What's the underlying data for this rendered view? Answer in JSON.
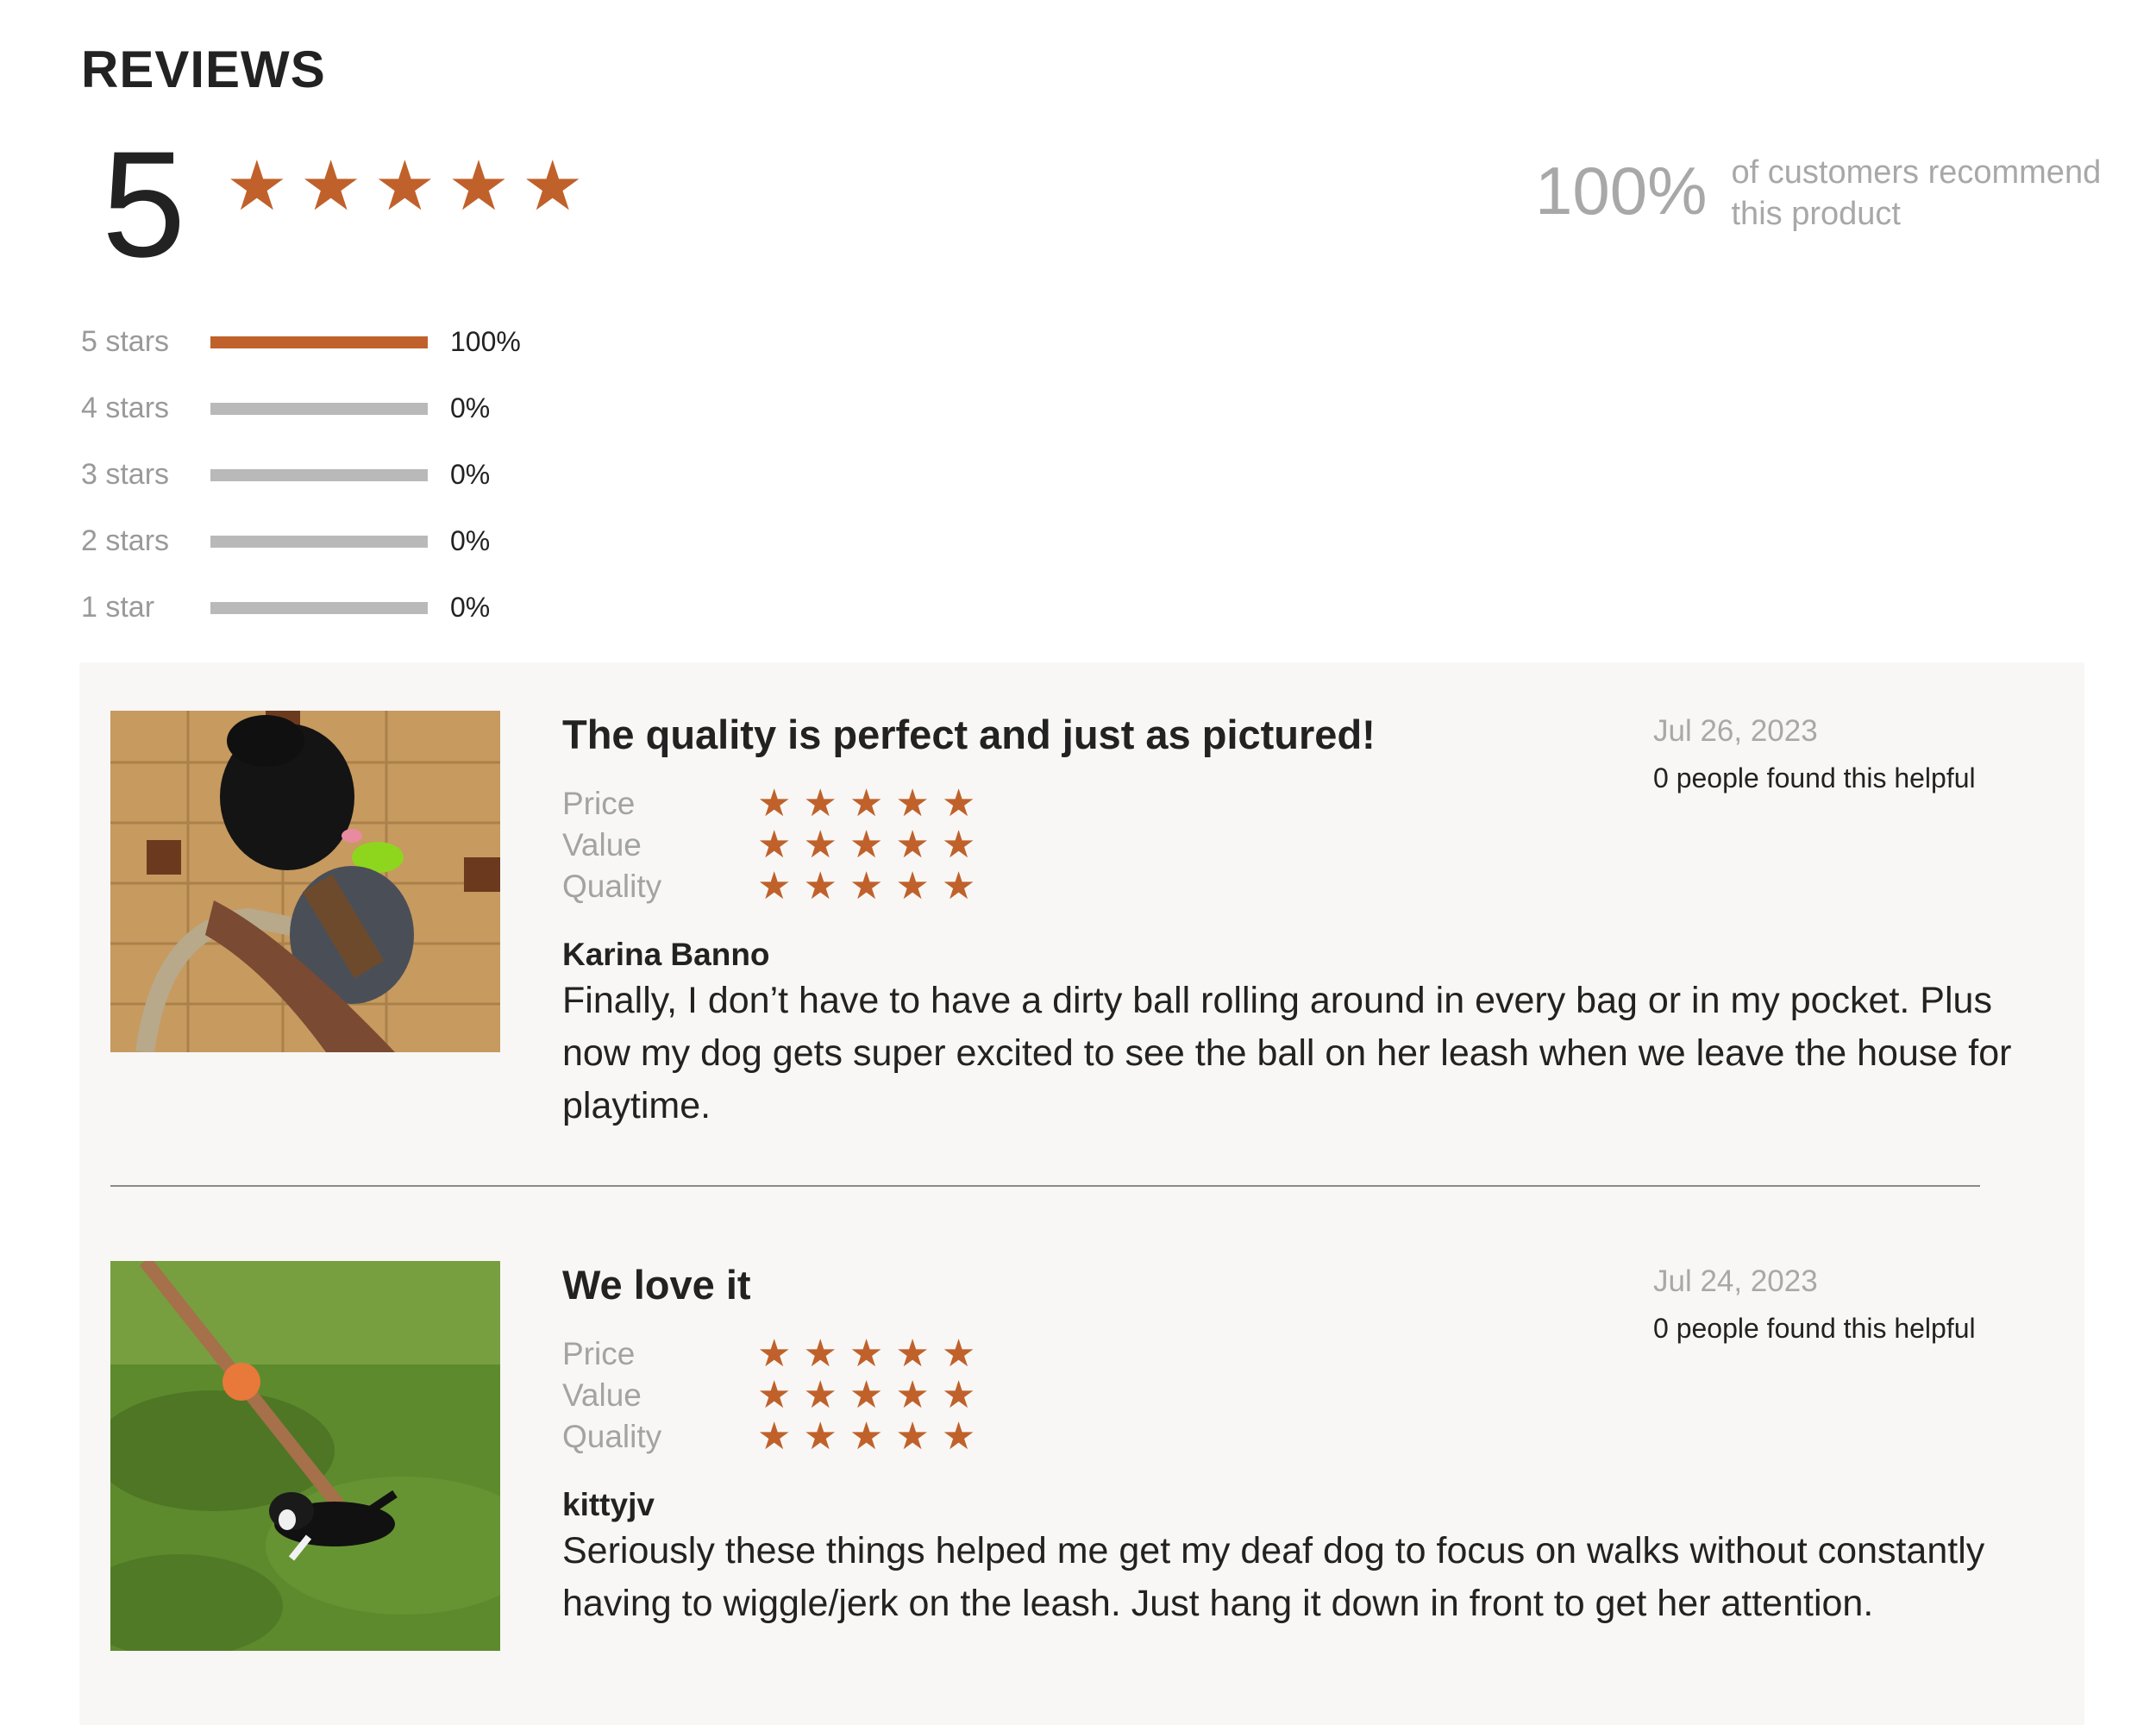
{
  "reviews_section": {
    "heading": "REVIEWS",
    "average_rating": "5",
    "average_stars": 5,
    "recommend": {
      "percent": "100%",
      "text": "of customers recommend this product"
    },
    "distribution": [
      {
        "label": "5 stars",
        "percent_text": "100%",
        "fraction": 1.0
      },
      {
        "label": "4 stars",
        "percent_text": "0%",
        "fraction": 0.0
      },
      {
        "label": "3 stars",
        "percent_text": "0%",
        "fraction": 0.0
      },
      {
        "label": "2 stars",
        "percent_text": "0%",
        "fraction": 0.0
      },
      {
        "label": "1 star",
        "percent_text": "0%",
        "fraction": 0.0
      }
    ]
  },
  "reviews": [
    {
      "title": "The quality is perfect and just as pictured!",
      "date": "Jul 26, 2023",
      "helpful": "0 people found this helpful",
      "ratings": [
        {
          "label": "Price",
          "stars": 5
        },
        {
          "label": "Value",
          "stars": 5
        },
        {
          "label": "Quality",
          "stars": 5
        }
      ],
      "author": "Karina Banno",
      "body": "Finally, I don’t have to have a dirty ball rolling around in every bag or in my pocket. Plus now my dog gets super excited to see the ball on her leash when we leave the house for playtime.",
      "photo": "dog-with-ball-leash-photo"
    },
    {
      "title": "We love it",
      "date": "Jul 24, 2023",
      "helpful": "0 people found this helpful",
      "ratings": [
        {
          "label": "Price",
          "stars": 5
        },
        {
          "label": "Value",
          "stars": 5
        },
        {
          "label": "Quality",
          "stars": 5
        }
      ],
      "author": "kittyjv",
      "body": "Seriously these things helped me get my deaf dog to focus on walks without constantly having to wiggle/jerk on the leash. Just hang it down in front to get her attention.",
      "photo": "dog-on-grass-photo"
    }
  ],
  "colors": {
    "accent": "#c0612b",
    "muted": "#a8a8a8",
    "panel": "#f8f7f5"
  }
}
